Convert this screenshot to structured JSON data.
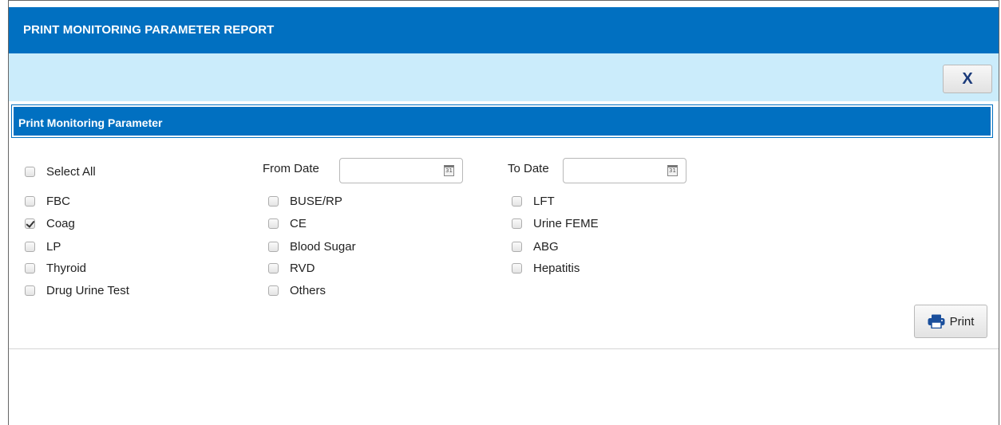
{
  "window": {
    "title": "PRINT MONITORING PARAMETER REPORT"
  },
  "toolbar": {
    "close_label": "X"
  },
  "section": {
    "title": "Print Monitoring Parameter"
  },
  "select_all": {
    "label": "Select All",
    "checked": false
  },
  "dates": {
    "from_label": "From Date",
    "from_value": "",
    "to_label": "To Date",
    "to_value": "",
    "calendar_glyph": "31"
  },
  "columns": [
    [
      {
        "label": "FBC",
        "checked": false
      },
      {
        "label": "Coag",
        "checked": true
      },
      {
        "label": "LP",
        "checked": false
      },
      {
        "label": "Thyroid",
        "checked": false
      },
      {
        "label": "Drug Urine Test",
        "checked": false
      }
    ],
    [
      {
        "label": "BUSE/RP",
        "checked": false
      },
      {
        "label": "CE",
        "checked": false
      },
      {
        "label": "Blood Sugar",
        "checked": false
      },
      {
        "label": "RVD",
        "checked": false
      },
      {
        "label": "Others",
        "checked": false
      }
    ],
    [
      {
        "label": "LFT",
        "checked": false
      },
      {
        "label": "Urine FEME",
        "checked": false
      },
      {
        "label": "ABG",
        "checked": false
      },
      {
        "label": "Hepatitis",
        "checked": false
      }
    ]
  ],
  "actions": {
    "print_label": "Print"
  },
  "colors": {
    "header_blue": "#0170c1",
    "toolbar_light": "#cbecfb",
    "icon_blue": "#1a4f9c"
  }
}
